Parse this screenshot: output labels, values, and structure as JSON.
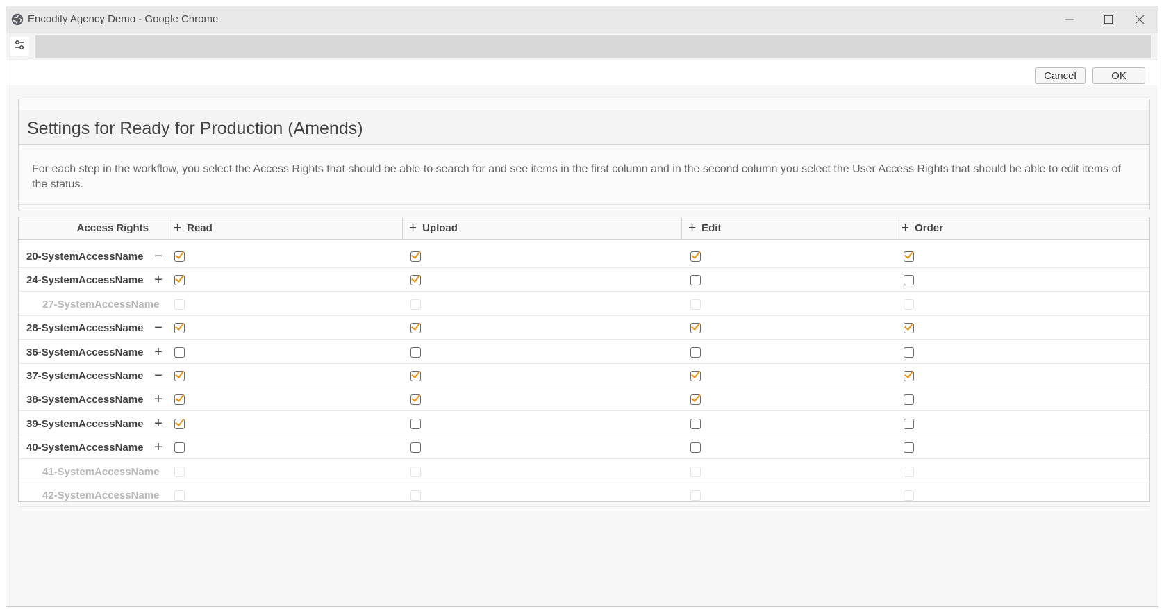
{
  "window": {
    "title": "Encodify Agency Demo - Google Chrome"
  },
  "icons": {
    "app": "globe-icon",
    "minimize": "minimize-icon",
    "maximize": "maximize-icon",
    "close": "close-icon",
    "tune": "tune-icon"
  },
  "actions": {
    "cancel": "Cancel",
    "ok": "OK"
  },
  "panel": {
    "title": "Settings for Ready for Production (Amends)",
    "description": "For each step in the workflow, you select the Access Rights that should be able to search for and see items in the first column and in the second column you select the User Access Rights that should be able to edit items of the status."
  },
  "grid": {
    "header_label": "Access Rights",
    "columns": [
      "Read",
      "Upload",
      "Edit",
      "Order"
    ],
    "rows": [
      {
        "name": "20-SystemAccessName",
        "toggle": "−",
        "enabled": true,
        "checks": [
          true,
          true,
          true,
          true
        ]
      },
      {
        "name": "24-SystemAccessName",
        "toggle": "+",
        "enabled": true,
        "checks": [
          true,
          true,
          false,
          false
        ]
      },
      {
        "name": "27-SystemAccessName",
        "toggle": "",
        "enabled": false,
        "checks": [
          false,
          false,
          false,
          false
        ]
      },
      {
        "name": "28-SystemAccessName",
        "toggle": "−",
        "enabled": true,
        "checks": [
          true,
          true,
          true,
          true
        ]
      },
      {
        "name": "36-SystemAccessName",
        "toggle": "+",
        "enabled": true,
        "checks": [
          false,
          false,
          false,
          false
        ]
      },
      {
        "name": "37-SystemAccessName",
        "toggle": "−",
        "enabled": true,
        "checks": [
          true,
          true,
          true,
          true
        ]
      },
      {
        "name": "38-SystemAccessName",
        "toggle": "+",
        "enabled": true,
        "checks": [
          true,
          true,
          true,
          false
        ]
      },
      {
        "name": "39-SystemAccessName",
        "toggle": "+",
        "enabled": true,
        "checks": [
          true,
          false,
          false,
          false
        ]
      },
      {
        "name": "40-SystemAccessName",
        "toggle": "+",
        "enabled": true,
        "checks": [
          false,
          false,
          false,
          false
        ]
      },
      {
        "name": "41-SystemAccessName",
        "toggle": "",
        "enabled": false,
        "checks": [
          false,
          false,
          false,
          false
        ]
      },
      {
        "name": "42-SystemAccessName",
        "toggle": "",
        "enabled": false,
        "checks": [
          false,
          false,
          false,
          false
        ]
      }
    ]
  },
  "colors": {
    "check_mark": "#f0900a"
  }
}
